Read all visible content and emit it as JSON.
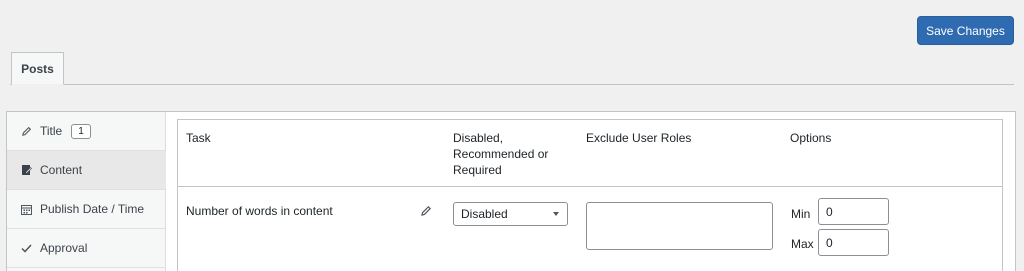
{
  "toolbar": {
    "save_label": "Save Changes"
  },
  "tabs": [
    {
      "label": "Posts"
    }
  ],
  "sidebar": {
    "items": [
      {
        "label": "Title",
        "icon": "pencil-icon",
        "badge": "1"
      },
      {
        "label": "Content",
        "icon": "document-icon"
      },
      {
        "label": "Publish Date / Time",
        "icon": "calendar-icon"
      },
      {
        "label": "Approval",
        "icon": "checkmark-icon"
      }
    ]
  },
  "table": {
    "headers": [
      "Task",
      "Disabled,\nRecommended or\nRequired",
      "Exclude User Roles",
      "Options"
    ],
    "rows": [
      {
        "task": "Number of words in content",
        "status": "Disabled",
        "exclude_roles": "",
        "min_label": "Min",
        "min_value": "0",
        "max_label": "Max",
        "max_value": "0"
      }
    ]
  },
  "colors": {
    "primary": "#2f6bb0",
    "background": "#f0f0f1"
  }
}
